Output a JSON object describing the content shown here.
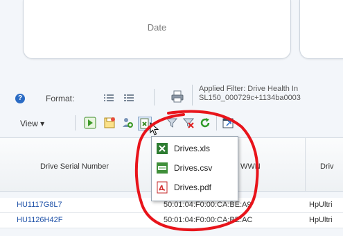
{
  "cards": {
    "date_label": "Date"
  },
  "format_bar": {
    "format_label": "Format:",
    "filter_line1": "Applied Filter: Drive Health In",
    "filter_line2": "SL150_000729c+1134ba0003"
  },
  "toolbar": {
    "view_label": "View ▾"
  },
  "table": {
    "headers": {
      "serial": "Drive Serial Number",
      "wwn": "WWN",
      "third": "Driv"
    },
    "rows": [
      {
        "serial": "HU1117G8L7",
        "wwn": "50:01:04:F0:00:CA:BE:A9",
        "third": "HpUltri"
      },
      {
        "serial": "HU1126H42F",
        "wwn": "50:01:04:F0:00:CA:BE:AC",
        "third": "HpUltri"
      }
    ]
  },
  "export_menu": {
    "items": [
      {
        "label": "Drives.xls"
      },
      {
        "label": "Drives.csv"
      },
      {
        "label": "Drives.pdf"
      }
    ]
  },
  "colors": {
    "annotation": "#e8141b",
    "link_blue": "#1f52a8",
    "help_blue": "#2a6bc4"
  }
}
